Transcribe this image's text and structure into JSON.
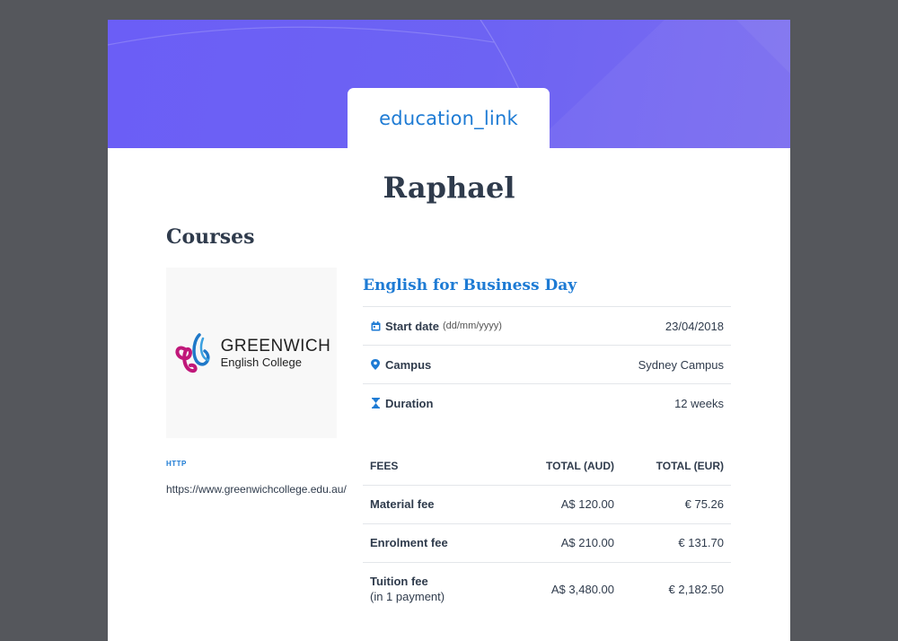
{
  "brand": {
    "logo_text": "education_link",
    "accent": "#1e7bd4",
    "hero_color": "#6b5ef6"
  },
  "student": {
    "name": "Raphael"
  },
  "section": {
    "title": "Courses"
  },
  "school": {
    "logo_name": "GREENWICH",
    "logo_sub": "English College",
    "link_label": "HTTP",
    "url": "https://www.greenwichcollege.edu.au/"
  },
  "course": {
    "title": "English for Business Day",
    "details": [
      {
        "icon": "calendar-icon",
        "label": "Start date",
        "hint": "(dd/mm/yyyy)",
        "value": "23/04/2018"
      },
      {
        "icon": "map-pin-icon",
        "label": "Campus",
        "hint": "",
        "value": "Sydney Campus"
      },
      {
        "icon": "hourglass-icon",
        "label": "Duration",
        "hint": "",
        "value": "12 weeks"
      }
    ]
  },
  "fees": {
    "headers": [
      "FEES",
      "TOTAL (AUD)",
      "TOTAL (EUR)"
    ],
    "rows": [
      {
        "name": "Material fee",
        "note": "",
        "aud": "A$ 120.00",
        "eur": "€ 75.26"
      },
      {
        "name": "Enrolment fee",
        "note": "",
        "aud": "A$ 210.00",
        "eur": "€ 131.70"
      },
      {
        "name": "Tuition fee",
        "note": "(in 1 payment)",
        "aud": "A$ 3,480.00",
        "eur": "€ 2,182.50"
      }
    ]
  }
}
